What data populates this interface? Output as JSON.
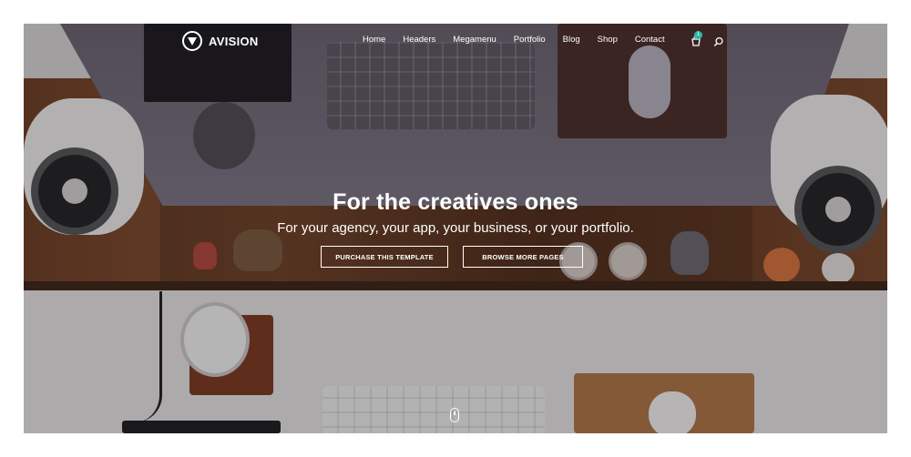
{
  "brand": {
    "name": "AVISION"
  },
  "nav": {
    "items": [
      {
        "label": "Home"
      },
      {
        "label": "Headers"
      },
      {
        "label": "Megamenu"
      },
      {
        "label": "Portfolio"
      },
      {
        "label": "Blog"
      },
      {
        "label": "Shop"
      },
      {
        "label": "Contact"
      }
    ],
    "cart_count": "1",
    "icons": {
      "cart": "cart-icon",
      "search": "search-icon"
    }
  },
  "hero": {
    "title": "For the creatives ones",
    "subtitle": "For your agency, your app, your business, or your portfolio.",
    "buttons": {
      "purchase": "PURCHASE THIS TEMPLATE",
      "browse": "BROWSE MORE PAGES"
    }
  },
  "colors": {
    "text": "#ffffff",
    "badge": "#2ab7a9"
  }
}
